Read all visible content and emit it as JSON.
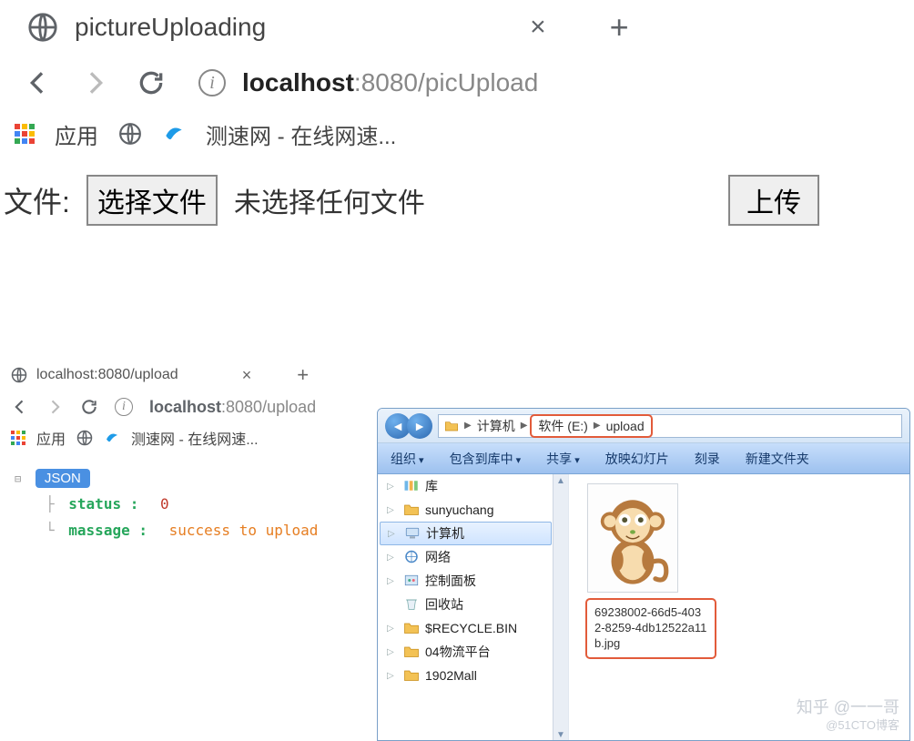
{
  "top_window": {
    "tab": {
      "title": "pictureUploading",
      "close": "×",
      "new": "+"
    },
    "address": {
      "host": "localhost",
      "port": ":8080",
      "path": "/picUpload"
    },
    "bookmarks": {
      "apps": "应用",
      "speedtest": "测速网 - 在线网速..."
    },
    "page": {
      "file_label": "文件:",
      "choose_button": "选择文件",
      "no_file": "未选择任何文件",
      "upload_button": "上传"
    }
  },
  "lower_window": {
    "tab": {
      "title": "localhost:8080/upload",
      "close": "×",
      "new": "+"
    },
    "address": {
      "host": "localhost",
      "port": ":8080",
      "path": "/upload"
    },
    "bookmarks": {
      "apps": "应用",
      "speedtest": "测速网 - 在线网速..."
    },
    "json": {
      "badge": "JSON",
      "status_key": "status :",
      "status_val": "0",
      "message_key": "massage :",
      "message_val": "success to upload"
    }
  },
  "explorer": {
    "breadcrumb": {
      "pc": "计算机",
      "drive": "软件 (E:)",
      "folder": "upload"
    },
    "menu": {
      "org": "组织",
      "addlib": "包含到库中",
      "share": "共享",
      "slideshow": "放映幻灯片",
      "burn": "刻录",
      "newfolder": "新建文件夹"
    },
    "tree": [
      {
        "label": "库",
        "icon": "library"
      },
      {
        "label": "sunyuchang",
        "icon": "folder"
      },
      {
        "label": "计算机",
        "icon": "computer",
        "selected": true
      },
      {
        "label": "网络",
        "icon": "network"
      },
      {
        "label": "控制面板",
        "icon": "control"
      },
      {
        "label": "回收站",
        "icon": "recycle"
      },
      {
        "label": "$RECYCLE.BIN",
        "icon": "folder"
      },
      {
        "label": "04物流平台",
        "icon": "folder"
      },
      {
        "label": "1902Mall",
        "icon": "folder"
      }
    ],
    "file": {
      "name": "69238002-66d5-4032-8259-4db12522a11b.jpg"
    }
  },
  "watermark": {
    "main": "知乎 @一一哥",
    "sub": "@51CTO博客"
  }
}
